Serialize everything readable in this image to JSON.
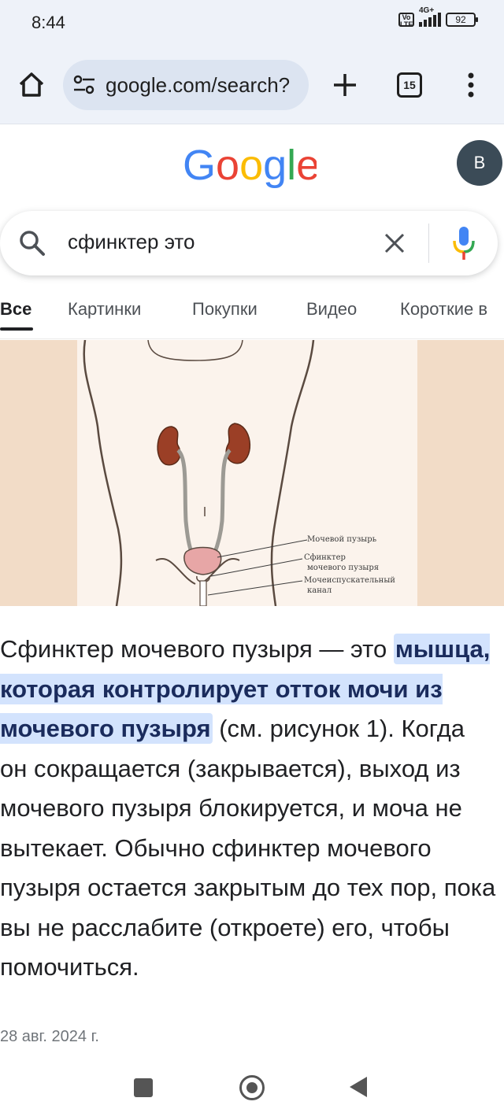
{
  "status_bar": {
    "time": "8:44",
    "volte": "Vo LTE",
    "network": "4G+",
    "battery": "92"
  },
  "browser": {
    "url": "google.com/search?",
    "tab_count": "15",
    "icons": [
      "home-icon",
      "site-info-icon",
      "plus-icon",
      "tabs-icon",
      "more-vert-icon"
    ]
  },
  "header": {
    "logo": "Google",
    "logo_colors": [
      "#4285F4",
      "#EA4335",
      "#FBBC05",
      "#4285F4",
      "#34A853",
      "#EA4335"
    ],
    "avatar_letter": "B"
  },
  "search": {
    "query": "сфинктер это"
  },
  "tabs": [
    {
      "label": "Все",
      "active": true
    },
    {
      "label": "Картинки",
      "active": false
    },
    {
      "label": "Покупки",
      "active": false
    },
    {
      "label": "Видео",
      "active": false
    },
    {
      "label": "Короткие в",
      "active": false
    }
  ],
  "image": {
    "labels": [
      "Мочевой пузырь",
      "Сфинктер",
      "мочевого пузыря",
      "Мочеиспускательный",
      "канал"
    ]
  },
  "answer": {
    "before": "Сфинктер мочевого пузыря — это ",
    "highlight": "мышца, которая контролирует отток мочи из мочевого пузыря",
    "after": " (см. рисунок 1). Когда он сокращается (закрывается), выход из мочевого пузыря блокируется, и моча не вытекает. Обычно сфинктер мочевого пузыря остается закрытым до тех пор, пока вы не расслабите (откроете) его, чтобы помочиться.",
    "date": "28 авг. 2024 г."
  },
  "colors": {
    "accent": "#1a73e8",
    "highlight_bg": "#d3e3fd",
    "browser_bg": "#eef2f9",
    "image_bg": "#f2dcc7"
  }
}
